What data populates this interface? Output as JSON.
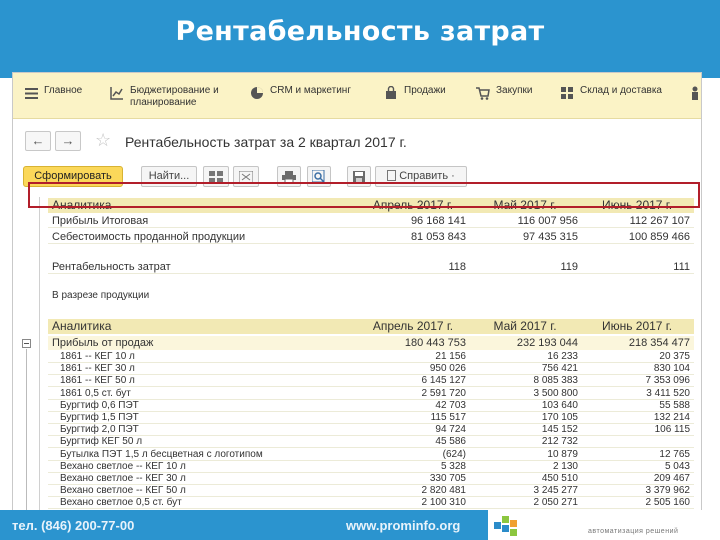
{
  "slide": {
    "title": "Рентабельность затрат",
    "footer_phone": "тел. (846) 200-77-00",
    "footer_site": "www.prominfo.org",
    "logo_text": "",
    "logo_tagline": "автоматизация решений"
  },
  "menu": [
    {
      "label": "Главное",
      "icon": "menu-lines-icon"
    },
    {
      "label": "Бюджетирование и\nпланирование",
      "icon": "chart-icon"
    },
    {
      "label": "CRM и маркетинг",
      "icon": "pie-icon"
    },
    {
      "label": "Продажи",
      "icon": "bag-icon"
    },
    {
      "label": "Закупки",
      "icon": "cart-icon"
    },
    {
      "label": "Склад и доставка",
      "icon": "warehouse-icon"
    }
  ],
  "nav": {
    "back": "←",
    "forward": "→",
    "star": "☆",
    "form_title": "Рентабельность затрат  за 2 квартал 2017 г."
  },
  "toolbar": {
    "generate": "Сформировать",
    "find": "Найти...",
    "more": "Справить ·"
  },
  "table1": {
    "headers": [
      "Аналитика",
      "Апрель 2017 г.",
      "Май 2017 г.",
      "Июнь 2017 г."
    ],
    "rows": [
      [
        "Прибыль Итоговая",
        "96 168 141",
        "116 007 956",
        "112 267 107"
      ],
      [
        "Себестоимость проданной продукции",
        "81 053 843",
        "97 435 315",
        "100 859 466"
      ]
    ],
    "highlight": [
      "Рентабельность затрат",
      "118",
      "119",
      "111"
    ]
  },
  "section_label": "В разрезе продукции",
  "table2": {
    "headers": [
      "Аналитика",
      "Апрель 2017 г.",
      "Май 2017 г.",
      "Июнь 2017 г."
    ],
    "group": [
      "Прибыль от продаж",
      "180 443 753",
      "232 193 044",
      "218 354 477"
    ],
    "rows": [
      [
        "1861 -- КЕГ 10 л",
        "21 156",
        "16 233",
        "20 375"
      ],
      [
        "1861 -- КЕГ 30 л",
        "950 026",
        "756 421",
        "830 104"
      ],
      [
        "1861 -- КЕГ 50 л",
        "6 145 127",
        "8 085 383",
        "7 353 096"
      ],
      [
        "1861 0,5 ст. бут",
        "2 591 720",
        "3 500 800",
        "3 411 520"
      ],
      [
        "Бургтиф 0,6 ПЭТ",
        "42 703",
        "103 640",
        "55 588"
      ],
      [
        "Бургтиф 1,5 ПЭТ",
        "115 517",
        "170 105",
        "132 214"
      ],
      [
        "Бургтиф 2,0 ПЭТ",
        "94 724",
        "145 152",
        "106 115"
      ],
      [
        "Бургтиф КЕГ 50 л",
        "45 586",
        "212 732",
        ""
      ],
      [
        "Бутылка ПЭТ 1,5 л бесцветная с логотипом",
        "(624)",
        "10 879",
        "12 765"
      ],
      [
        "Вехано светлое -- КЕГ 10 л",
        "5 328",
        "2 130",
        "5 043"
      ],
      [
        "Вехано светлое -- КЕГ 30 л",
        "330 705",
        "450 510",
        "209 467"
      ],
      [
        "Вехано светлое -- КЕГ 50 л",
        "2 820 481",
        "3 245 277",
        "3 379 962"
      ],
      [
        "Вехано светлое 0,5 ст. бут",
        "2 100 310",
        "2 050 271",
        "2 505 160"
      ]
    ]
  }
}
